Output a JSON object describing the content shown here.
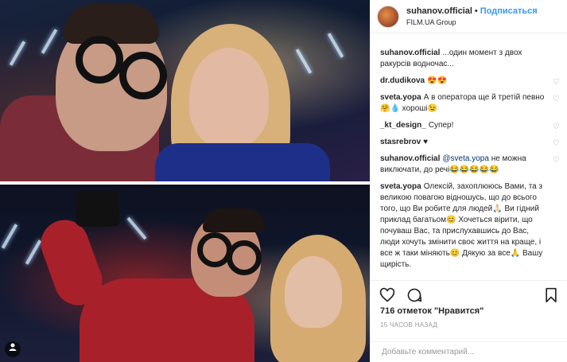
{
  "header": {
    "username": "suhanov.official",
    "separator": "•",
    "follow_label": "Подписаться",
    "location": "FILM.UA Group"
  },
  "caption": {
    "username": "suhanov.official",
    "text": "...один момент з двох ракурсів водночас..."
  },
  "comments": [
    {
      "username": "dr.dudikova",
      "text": "😍😍"
    },
    {
      "username": "sveta.yopa",
      "text": "А в оператора ще й третій певно 🤗💧 хороші😉"
    },
    {
      "username": "_kt_design_",
      "text": "Супер!"
    },
    {
      "username": "stasrebrov",
      "text": "♥"
    },
    {
      "username": "suhanov.official",
      "mention": "@sveta.yopa",
      "text": "не можна виключати, до речі😂😂😂😂😂"
    },
    {
      "username": "sveta.yopa",
      "text": "Олексій, захоплююсь Вами, та з великою повагою відношусь, що до всього того, що Ви робите для людей🙏🏻 Ви гідний приклад багатьом😊 Хочеться вірити, що почуваш Вас, та прислухавшись до Вас, люди хочуть змінити своє життя на краще, і все ж таки міняють😊 Дякую за все🙏 Вашу щирість."
    }
  ],
  "likes": "716 отметок \"Нравится\"",
  "time": "15 ЧАСОВ НАЗАД",
  "add_comment_placeholder": "Добавьте комментарий...",
  "icons": [
    "heart-icon",
    "comment-icon",
    "share-icon",
    "bookmark-icon"
  ]
}
